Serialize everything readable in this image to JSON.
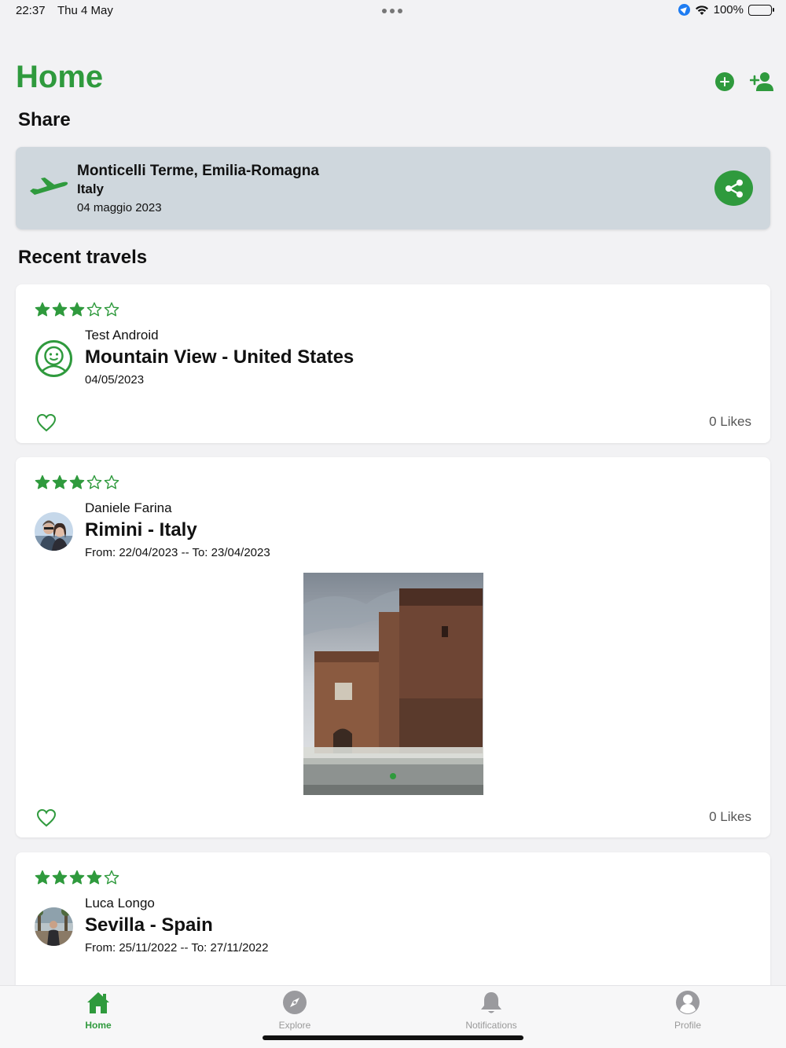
{
  "status_bar": {
    "time": "22:37",
    "date": "Thu 4 May",
    "battery": "100%"
  },
  "header": {
    "title": "Home"
  },
  "share": {
    "section_title": "Share",
    "location": "Monticelli Terme, Emilia-Romagna",
    "country": "Italy",
    "date": "04 maggio 2023"
  },
  "recent": {
    "section_title": "Recent travels",
    "items": [
      {
        "rating": 3,
        "author": "Test Android",
        "place": "Mountain View - United States",
        "dates": "04/05/2023",
        "likes": "0 Likes"
      },
      {
        "rating": 3,
        "author": "Daniele Farina",
        "place": "Rimini - Italy",
        "dates": "From: 22/04/2023 -- To: 23/04/2023",
        "likes": "0 Likes"
      },
      {
        "rating": 4,
        "author": "Luca Longo",
        "place": "Sevilla - Spain",
        "dates": "From: 25/11/2022 -- To: 27/11/2022"
      }
    ]
  },
  "tabs": [
    {
      "label": "Home",
      "icon": "home-icon",
      "active": true
    },
    {
      "label": "Explore",
      "icon": "compass-icon",
      "active": false
    },
    {
      "label": "Notifications",
      "icon": "bell-icon",
      "active": false
    },
    {
      "label": "Profile",
      "icon": "profile-icon",
      "active": false
    }
  ],
  "colors": {
    "accent": "#2f9a3d",
    "share_card": "#cfd7dd",
    "background": "#f2f2f4"
  }
}
